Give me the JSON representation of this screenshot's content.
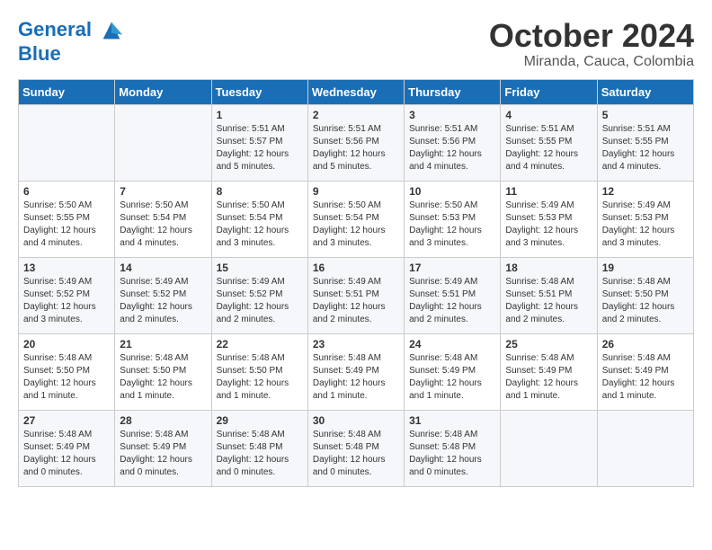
{
  "header": {
    "logo_line1": "General",
    "logo_line2": "Blue",
    "month": "October 2024",
    "location": "Miranda, Cauca, Colombia"
  },
  "days_of_week": [
    "Sunday",
    "Monday",
    "Tuesday",
    "Wednesday",
    "Thursday",
    "Friday",
    "Saturday"
  ],
  "weeks": [
    [
      {
        "day": "",
        "sunrise": "",
        "sunset": "",
        "daylight": ""
      },
      {
        "day": "",
        "sunrise": "",
        "sunset": "",
        "daylight": ""
      },
      {
        "day": "1",
        "sunrise": "Sunrise: 5:51 AM",
        "sunset": "Sunset: 5:57 PM",
        "daylight": "Daylight: 12 hours and 5 minutes."
      },
      {
        "day": "2",
        "sunrise": "Sunrise: 5:51 AM",
        "sunset": "Sunset: 5:56 PM",
        "daylight": "Daylight: 12 hours and 5 minutes."
      },
      {
        "day": "3",
        "sunrise": "Sunrise: 5:51 AM",
        "sunset": "Sunset: 5:56 PM",
        "daylight": "Daylight: 12 hours and 4 minutes."
      },
      {
        "day": "4",
        "sunrise": "Sunrise: 5:51 AM",
        "sunset": "Sunset: 5:55 PM",
        "daylight": "Daylight: 12 hours and 4 minutes."
      },
      {
        "day": "5",
        "sunrise": "Sunrise: 5:51 AM",
        "sunset": "Sunset: 5:55 PM",
        "daylight": "Daylight: 12 hours and 4 minutes."
      }
    ],
    [
      {
        "day": "6",
        "sunrise": "Sunrise: 5:50 AM",
        "sunset": "Sunset: 5:55 PM",
        "daylight": "Daylight: 12 hours and 4 minutes."
      },
      {
        "day": "7",
        "sunrise": "Sunrise: 5:50 AM",
        "sunset": "Sunset: 5:54 PM",
        "daylight": "Daylight: 12 hours and 4 minutes."
      },
      {
        "day": "8",
        "sunrise": "Sunrise: 5:50 AM",
        "sunset": "Sunset: 5:54 PM",
        "daylight": "Daylight: 12 hours and 3 minutes."
      },
      {
        "day": "9",
        "sunrise": "Sunrise: 5:50 AM",
        "sunset": "Sunset: 5:54 PM",
        "daylight": "Daylight: 12 hours and 3 minutes."
      },
      {
        "day": "10",
        "sunrise": "Sunrise: 5:50 AM",
        "sunset": "Sunset: 5:53 PM",
        "daylight": "Daylight: 12 hours and 3 minutes."
      },
      {
        "day": "11",
        "sunrise": "Sunrise: 5:49 AM",
        "sunset": "Sunset: 5:53 PM",
        "daylight": "Daylight: 12 hours and 3 minutes."
      },
      {
        "day": "12",
        "sunrise": "Sunrise: 5:49 AM",
        "sunset": "Sunset: 5:53 PM",
        "daylight": "Daylight: 12 hours and 3 minutes."
      }
    ],
    [
      {
        "day": "13",
        "sunrise": "Sunrise: 5:49 AM",
        "sunset": "Sunset: 5:52 PM",
        "daylight": "Daylight: 12 hours and 3 minutes."
      },
      {
        "day": "14",
        "sunrise": "Sunrise: 5:49 AM",
        "sunset": "Sunset: 5:52 PM",
        "daylight": "Daylight: 12 hours and 2 minutes."
      },
      {
        "day": "15",
        "sunrise": "Sunrise: 5:49 AM",
        "sunset": "Sunset: 5:52 PM",
        "daylight": "Daylight: 12 hours and 2 minutes."
      },
      {
        "day": "16",
        "sunrise": "Sunrise: 5:49 AM",
        "sunset": "Sunset: 5:51 PM",
        "daylight": "Daylight: 12 hours and 2 minutes."
      },
      {
        "day": "17",
        "sunrise": "Sunrise: 5:49 AM",
        "sunset": "Sunset: 5:51 PM",
        "daylight": "Daylight: 12 hours and 2 minutes."
      },
      {
        "day": "18",
        "sunrise": "Sunrise: 5:48 AM",
        "sunset": "Sunset: 5:51 PM",
        "daylight": "Daylight: 12 hours and 2 minutes."
      },
      {
        "day": "19",
        "sunrise": "Sunrise: 5:48 AM",
        "sunset": "Sunset: 5:50 PM",
        "daylight": "Daylight: 12 hours and 2 minutes."
      }
    ],
    [
      {
        "day": "20",
        "sunrise": "Sunrise: 5:48 AM",
        "sunset": "Sunset: 5:50 PM",
        "daylight": "Daylight: 12 hours and 1 minute."
      },
      {
        "day": "21",
        "sunrise": "Sunrise: 5:48 AM",
        "sunset": "Sunset: 5:50 PM",
        "daylight": "Daylight: 12 hours and 1 minute."
      },
      {
        "day": "22",
        "sunrise": "Sunrise: 5:48 AM",
        "sunset": "Sunset: 5:50 PM",
        "daylight": "Daylight: 12 hours and 1 minute."
      },
      {
        "day": "23",
        "sunrise": "Sunrise: 5:48 AM",
        "sunset": "Sunset: 5:49 PM",
        "daylight": "Daylight: 12 hours and 1 minute."
      },
      {
        "day": "24",
        "sunrise": "Sunrise: 5:48 AM",
        "sunset": "Sunset: 5:49 PM",
        "daylight": "Daylight: 12 hours and 1 minute."
      },
      {
        "day": "25",
        "sunrise": "Sunrise: 5:48 AM",
        "sunset": "Sunset: 5:49 PM",
        "daylight": "Daylight: 12 hours and 1 minute."
      },
      {
        "day": "26",
        "sunrise": "Sunrise: 5:48 AM",
        "sunset": "Sunset: 5:49 PM",
        "daylight": "Daylight: 12 hours and 1 minute."
      }
    ],
    [
      {
        "day": "27",
        "sunrise": "Sunrise: 5:48 AM",
        "sunset": "Sunset: 5:49 PM",
        "daylight": "Daylight: 12 hours and 0 minutes."
      },
      {
        "day": "28",
        "sunrise": "Sunrise: 5:48 AM",
        "sunset": "Sunset: 5:49 PM",
        "daylight": "Daylight: 12 hours and 0 minutes."
      },
      {
        "day": "29",
        "sunrise": "Sunrise: 5:48 AM",
        "sunset": "Sunset: 5:48 PM",
        "daylight": "Daylight: 12 hours and 0 minutes."
      },
      {
        "day": "30",
        "sunrise": "Sunrise: 5:48 AM",
        "sunset": "Sunset: 5:48 PM",
        "daylight": "Daylight: 12 hours and 0 minutes."
      },
      {
        "day": "31",
        "sunrise": "Sunrise: 5:48 AM",
        "sunset": "Sunset: 5:48 PM",
        "daylight": "Daylight: 12 hours and 0 minutes."
      },
      {
        "day": "",
        "sunrise": "",
        "sunset": "",
        "daylight": ""
      },
      {
        "day": "",
        "sunrise": "",
        "sunset": "",
        "daylight": ""
      }
    ]
  ]
}
